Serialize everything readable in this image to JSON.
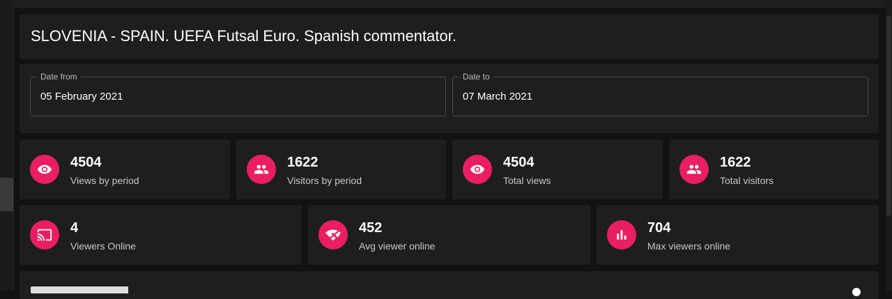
{
  "title": "SLOVENIA - SPAIN. UEFA Futsal Euro. Spanish commentator.",
  "date_from": {
    "label": "Date from",
    "value": "05 February 2021"
  },
  "date_to": {
    "label": "Date to",
    "value": "07 March 2021"
  },
  "stats_row1": [
    {
      "value": "4504",
      "label": "Views by period",
      "icon": "eye-icon"
    },
    {
      "value": "1622",
      "label": "Visitors by period",
      "icon": "people-icon"
    },
    {
      "value": "4504",
      "label": "Total views",
      "icon": "eye-icon"
    },
    {
      "value": "1622",
      "label": "Total visitors",
      "icon": "people-icon"
    }
  ],
  "stats_row2": [
    {
      "value": "4",
      "label": "Viewers Online",
      "icon": "cast-icon"
    },
    {
      "value": "452",
      "label": "Avg viewer online",
      "icon": "wifi-off-icon"
    },
    {
      "value": "704",
      "label": "Max viewers online",
      "icon": "bar-chart-icon"
    }
  ],
  "colors": {
    "accent": "#e91e63",
    "card": "#1e1e1e",
    "background": "#121212"
  }
}
